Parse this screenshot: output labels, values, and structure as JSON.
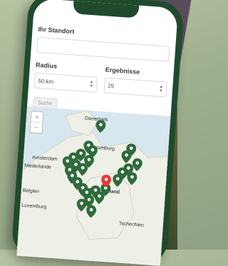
{
  "form": {
    "location_label": "Ihr Standort",
    "radius_label": "Radius",
    "radius_value": "50 km",
    "results_label": "Ergebnisse",
    "results_value": "25",
    "search_button": "Suche"
  },
  "map": {
    "zoom_in": "+",
    "zoom_out": "−",
    "labels": [
      "Danemark",
      "Hamburg",
      "Amsterdam",
      "Niederlande",
      "Belgien",
      "Deutschland",
      "Luxemburg",
      "Tschechien"
    ]
  },
  "colors": {
    "phone_frame": "#1f4a2c",
    "pin_green": "#2f6b3c",
    "pin_red": "#e53935",
    "map_water": "#d8e6ef",
    "map_land": "#eef0e7"
  }
}
